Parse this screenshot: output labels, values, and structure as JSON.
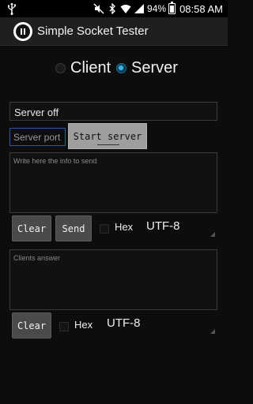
{
  "status_bar": {
    "battery_percent": "94%",
    "time": "08:58 AM"
  },
  "action_bar": {
    "title": "Simple Socket Tester"
  },
  "mode": {
    "options": [
      {
        "label": "Client",
        "selected": false
      },
      {
        "label": "Server",
        "selected": true
      }
    ]
  },
  "server": {
    "status_text": "Server off",
    "port_placeholder": "Server port",
    "start_label": "Start server"
  },
  "send": {
    "placeholder": "Write here the info to send",
    "clear_label": "Clear",
    "send_label": "Send",
    "hex_label": "Hex",
    "hex_checked": false,
    "encoding": "UTF-8"
  },
  "answer": {
    "placeholder": "Clients answer",
    "clear_label": "Clear",
    "hex_label": "Hex",
    "hex_checked": false,
    "encoding": "UTF-8"
  },
  "colors": {
    "accent": "#33b5e5",
    "background": "#0d0d0d"
  }
}
